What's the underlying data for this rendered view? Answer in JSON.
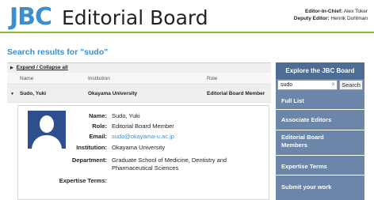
{
  "header": {
    "logo": "JBC",
    "title": "Editorial Board",
    "editor_in_chief_label": "Editor-In-Chief:",
    "editor_in_chief": "Alex Toker",
    "deputy_editor_label": "Deputy Editor:",
    "deputy_editor": "Henrik Dohlman"
  },
  "search_heading": "Search results for \"sudo\"",
  "results": {
    "expand_collapse": "Expand / Collapse all",
    "columns": [
      "Name",
      "Institution",
      "Role"
    ],
    "rows": [
      {
        "name": "Sudo, Yuki",
        "institution": "Okayama University",
        "role": "Editorial Board Member"
      }
    ],
    "detail": {
      "name_label": "Name:",
      "name": "Sudo, Yuki",
      "role_label": "Role:",
      "role": "Editorial Board Member",
      "email_label": "Email:",
      "email": "sudo@okayama-u.ac.jp",
      "institution_label": "Institution:",
      "institution": "Okayama University",
      "department_label": "Department:",
      "department": "Graduate School of Medicine, Dentistry and Pharmaceutical Sciences",
      "expertise_label": "Expertise Terms:",
      "expertise": ""
    }
  },
  "sidebar": {
    "title": "Explore the JBC Board",
    "search_value": "sudo",
    "clear": "x",
    "search_button": "Search",
    "items": [
      "Full List",
      "Associate Editors",
      "Editorial Board Members",
      "Expertise Terms",
      "Submit your work"
    ]
  },
  "colors": {
    "accent_blue": "#3b8fd0",
    "header_rule_green": "#8ab93a",
    "sidebar_bg": "#6b86a8",
    "sidebar_title_bg": "#4d6d94"
  }
}
